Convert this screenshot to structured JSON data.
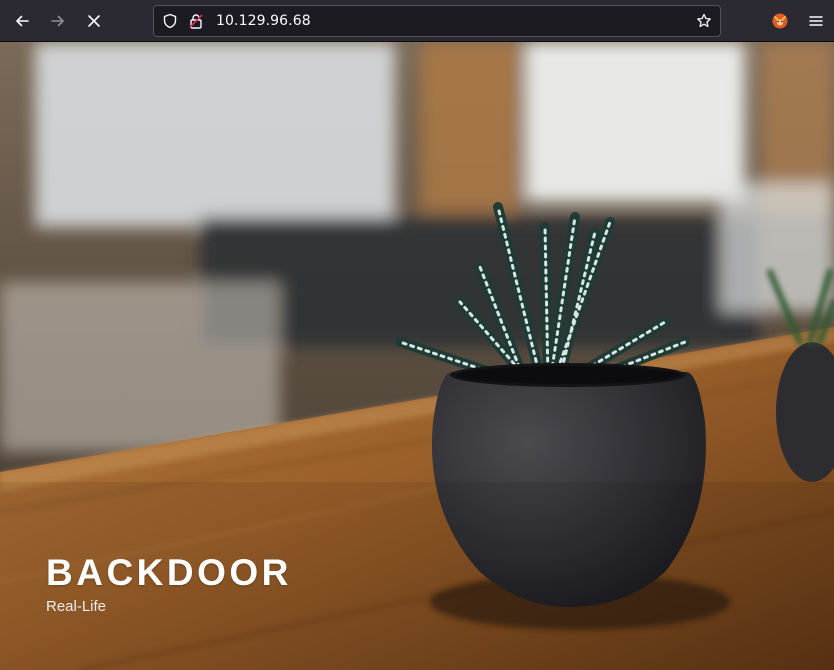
{
  "browser": {
    "url": "10.129.96.68",
    "icons": {
      "back": "arrow-left-icon",
      "forward": "arrow-right-icon",
      "stop": "close-icon",
      "tracking": "shield-icon",
      "security": "lock-warning-icon",
      "bookmark": "star-icon",
      "extension": "fox-extension-icon",
      "menu": "hamburger-menu-icon"
    }
  },
  "hero": {
    "title": "BACKDOOR",
    "subtitle": "Real-Life"
  },
  "colors": {
    "toolbar": "#2b2a33",
    "urlbar": "#1c1b22",
    "hero_text": "#ffffff"
  }
}
